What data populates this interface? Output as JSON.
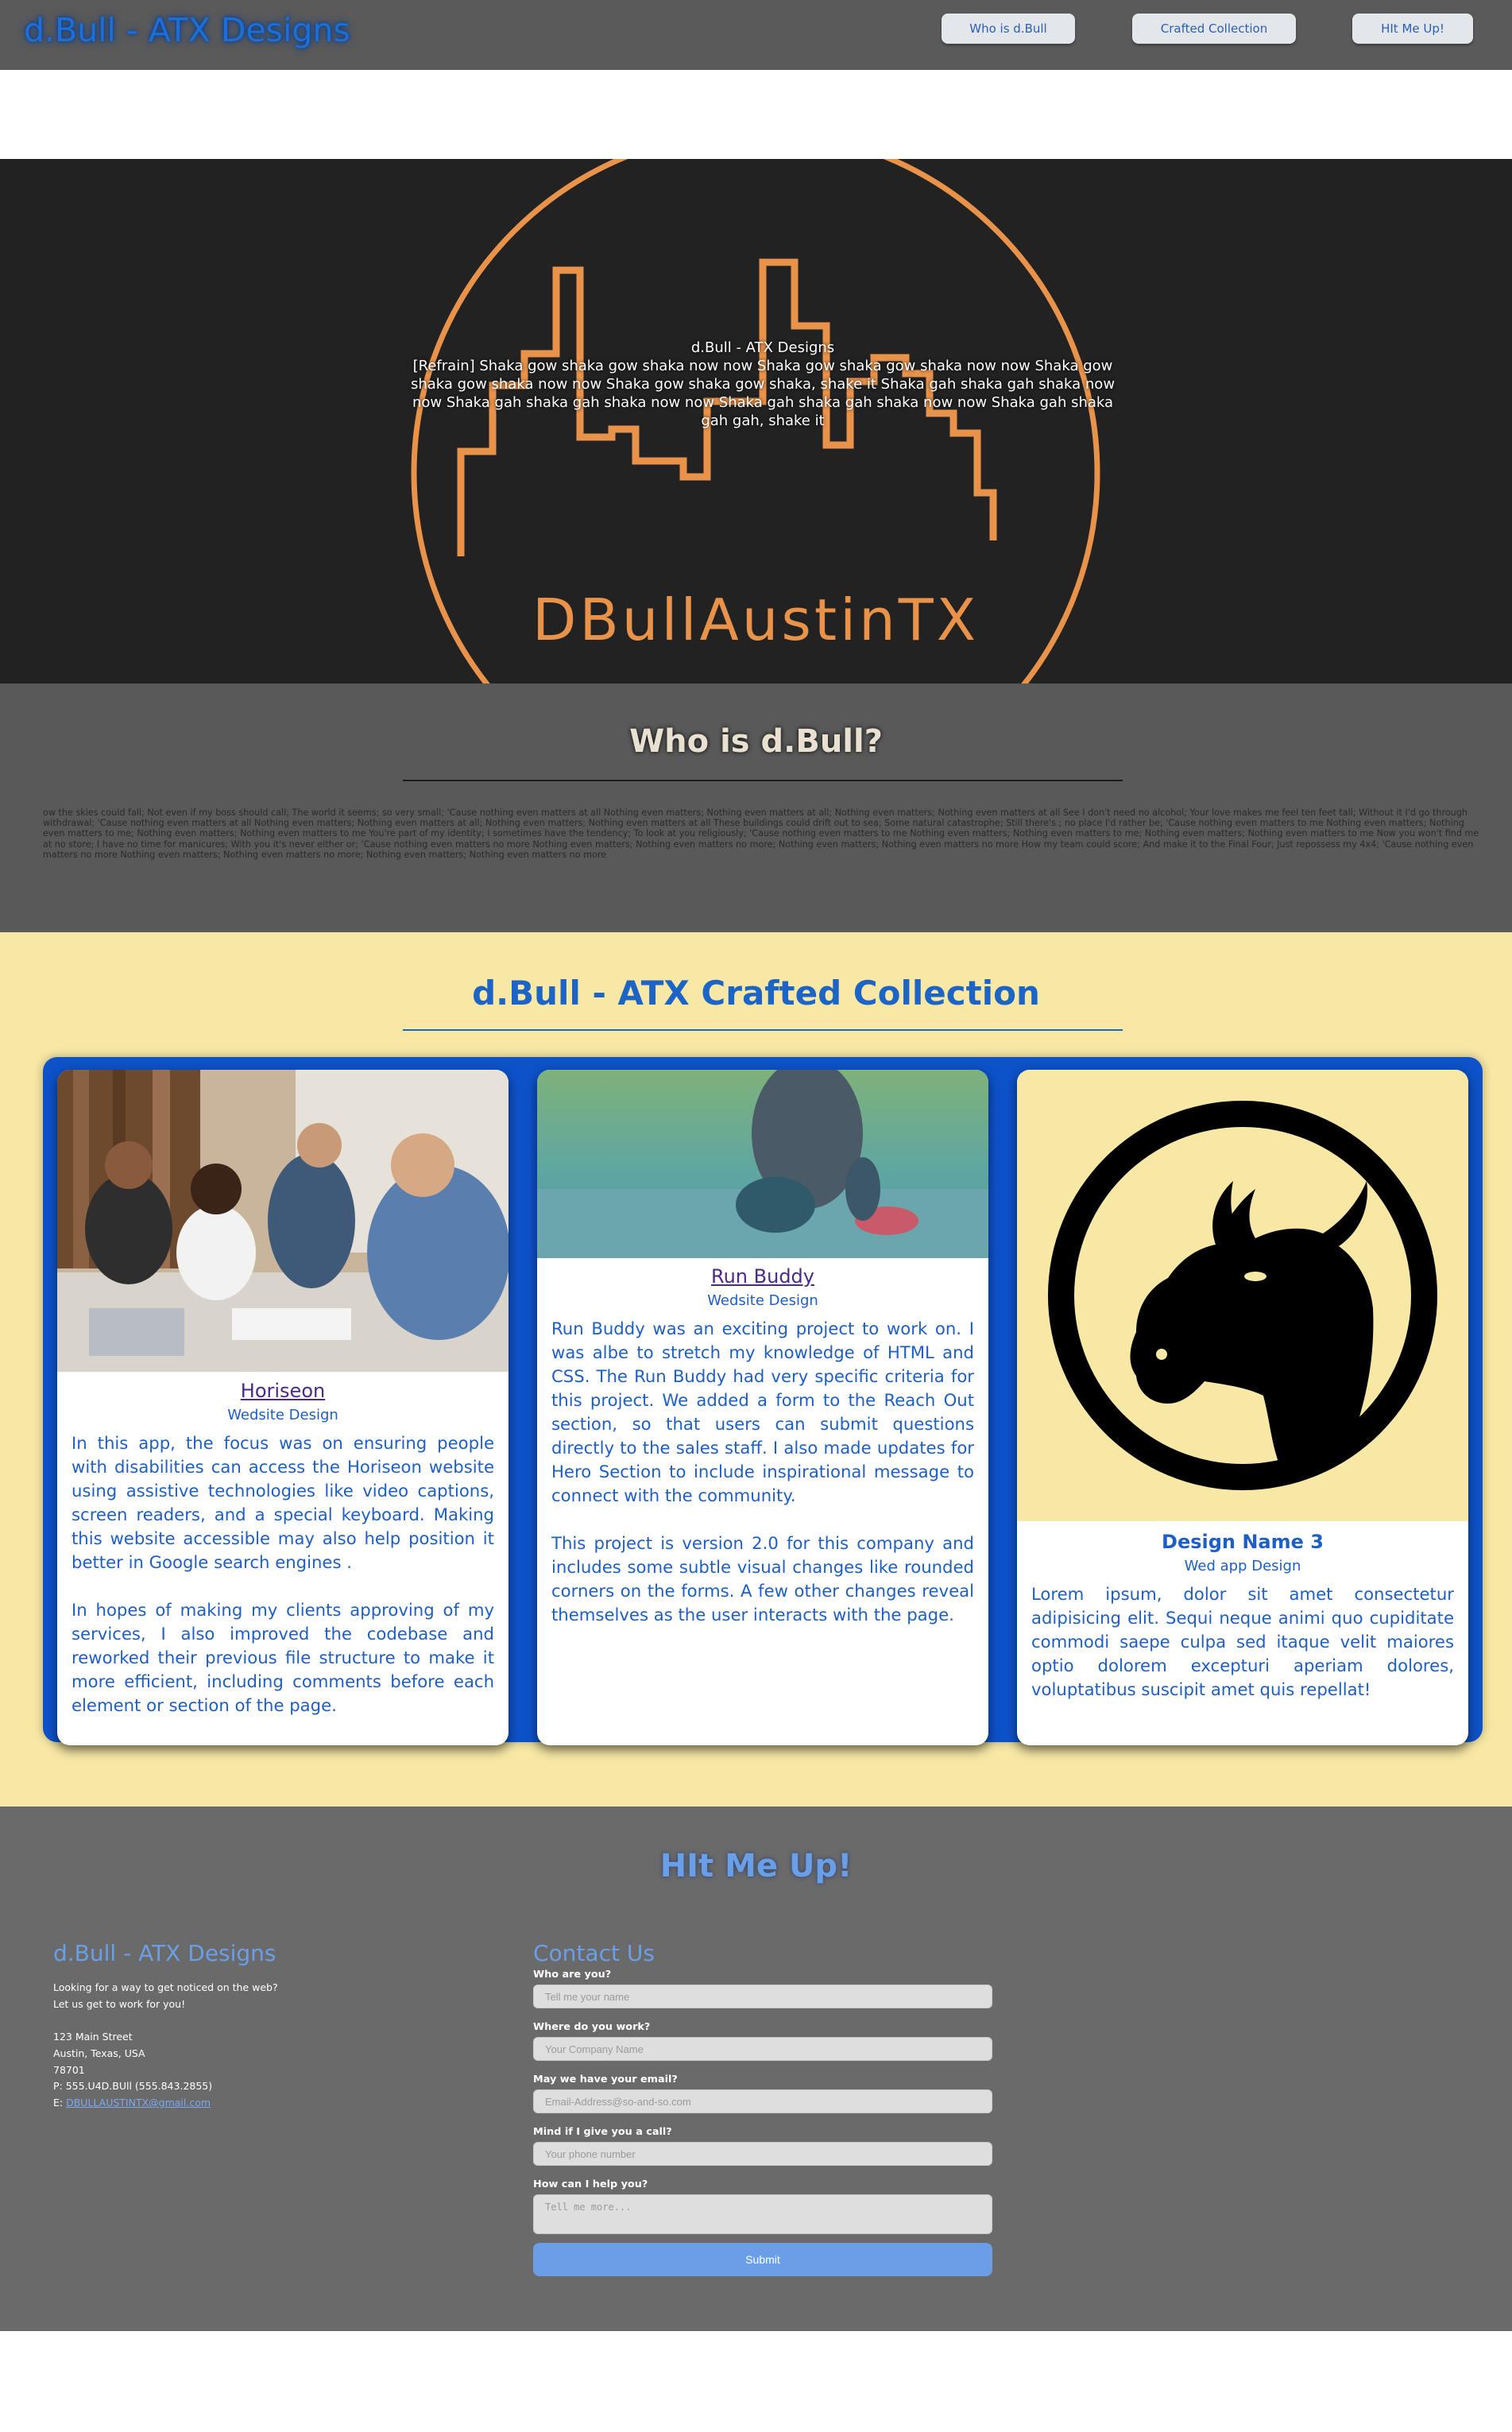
{
  "header": {
    "site_title": "d.Bull - ATX Designs",
    "nav": [
      {
        "label": "Who is d.Bull"
      },
      {
        "label": "Crafted Collection"
      },
      {
        "label": "HIt Me Up!"
      }
    ]
  },
  "hero": {
    "logo_text": "DBullAustinTX",
    "heading": "d.Bull - ATX Designs",
    "body": "[Refrain] Shaka gow shaka gow shaka now now Shaka gow shaka gow shaka now now Shaka gow shaka gow shaka now now Shaka gow shaka gow shaka, shake it Shaka gah shaka gah shaka now now Shaka gah shaka gah shaka now now Shaka gah shaka gah shaka now now Shaka gah shaka gah gah, shake it"
  },
  "about": {
    "title": "Who is d.Bull?",
    "body": "ow the skies could fall; Not even if my boss should call; The world it seems; so very small; 'Cause nothing even matters at all Nothing even matters; Nothing even matters at all; Nothing even matters; Nothing even matters at all See I don't need no alcohol; Your love makes me feel ten feet tall; Without it I'd go through withdrawal; 'Cause nothing even matters at all Nothing even matters; Nothing even matters at all; Nothing even matters; Nothing even matters at all These buildings could drift out to sea; Some natural catastrophe; Still there's ; no place I'd rather be; 'Cause nothing even matters to me Nothing even matters; Nothing even matters to me; Nothing even matters; Nothing even matters to me You're part of my identity; I sometimes have the tendency; To look at you religiously; 'Cause nothing even matters to me Nothing even matters; Nothing even matters to me; Nothing even matters; Nothing even matters to me Now you won't find me at no store; I have no time for manicures; With you it's never either or; 'Cause nothing even matters no more Nothing even matters; Nothing even matters no more; Nothing even matters; Nothing even matters no more How my team could score; And make it to the Final Four; Just repossess my 4x4; 'Cause nothing even matters no more Nothing even matters; Nothing even matters no more; Nothing even matters; Nothing even matters no more"
  },
  "portfolio": {
    "title": "d.Bull - ATX Crafted Collection",
    "projects": [
      {
        "title": "Horiseon",
        "subtitle": "Wedsite Design",
        "paragraphs": [
          "In this app, the focus was on ensuring people with disabilities can access the Horiseon website using assistive technologies like video captions, screen readers, and a special keyboard. Making this website accessible may also help position it better in Google search engines .",
          "In hopes of making my clients approving of my services, I also improved the codebase and reworked their previous file structure to make it more efficient, including comments before each element or section of the page."
        ]
      },
      {
        "title": "Run Buddy",
        "subtitle": "Wedsite Design",
        "paragraphs": [
          "Run Buddy was an exciting project to work on. I was albe to stretch my knowledge of HTML and CSS. The Run Buddy had very specific criteria for this project. We added a form to the Reach Out section, so that users can submit questions directly to the sales staff. I also made updates for Hero Section to include inspirational message to connect with the community.",
          "This project is version 2.0 for this company and includes some subtle visual changes like rounded corners on the forms. A few other changes reveal themselves as the user interacts with the page."
        ]
      },
      {
        "title": "Design Name 3",
        "subtitle": "Wed app Design",
        "paragraphs": [
          "Lorem ipsum, dolor sit amet consectetur adipisicing elit. Sequi neque animi quo cupiditate commodi saepe culpa sed itaque velit maiores optio dolorem excepturi aperiam dolores, voluptatibus suscipit amet quis repellat!"
        ]
      }
    ]
  },
  "contact": {
    "title": "HIt Me Up!",
    "info": {
      "title": "d.Bull - ATX Designs",
      "tagline1": "Looking for a way to get noticed on the web?",
      "tagline2": "Let us get to work for you!",
      "street": "123 Main Street",
      "city": "Austin, Texas, USA",
      "zip": "78701",
      "phone": "P: 555.U4D.BUll (555.843.2855)",
      "email_prefix": "E: ",
      "email": "DBULLAUSTINTX@gmail.com"
    },
    "form": {
      "title": "Contact Us",
      "fields": [
        {
          "label": "Who are you?",
          "placeholder": "Tell me your name"
        },
        {
          "label": "Where do you work?",
          "placeholder": "Your Company Name"
        },
        {
          "label": "May we have your email?",
          "placeholder": "Email-Address@so-and-so.com"
        },
        {
          "label": "Mind if I give you a call?",
          "placeholder": "Your phone number"
        },
        {
          "label": "How can I help you?",
          "placeholder": "Tell me more..."
        }
      ],
      "submit_label": "Submit"
    }
  },
  "colors": {
    "header_bg": "#5a5a5a",
    "accent_blue": "#1d64c7",
    "portfolio_bg": "#f8e8a6",
    "hero_orange": "#e8924a"
  }
}
